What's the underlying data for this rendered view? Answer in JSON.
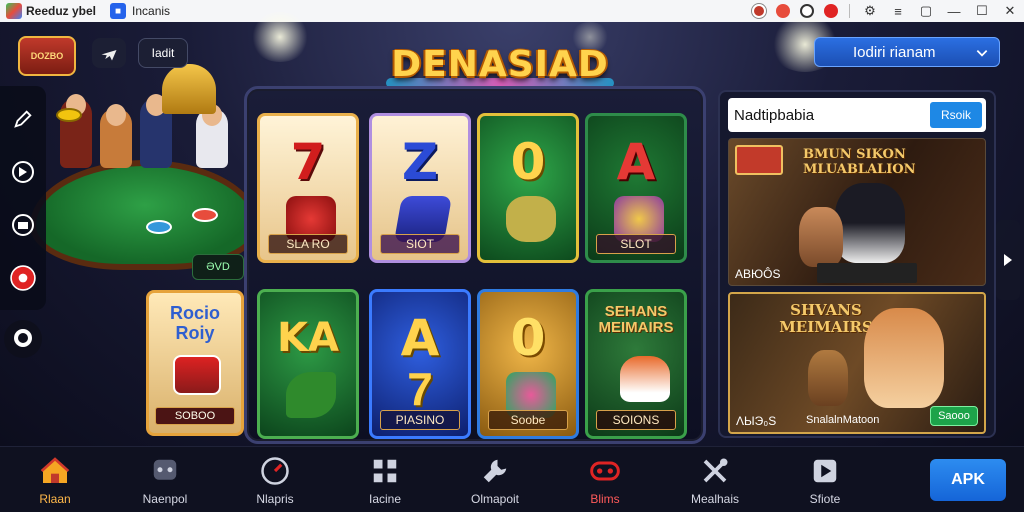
{
  "titlebar": {
    "app_name": "Reeduz ybel",
    "tab_name": "Incanis"
  },
  "top": {
    "logo_text": "DOZBO",
    "mode_chip": "Iadit",
    "select_label": "Iodiri rianam"
  },
  "game": {
    "title": "DENASIAD"
  },
  "table": {
    "tag": "ƏVD"
  },
  "reels": [
    {
      "symbol": "7",
      "label": "SLA RO",
      "theme": "cream"
    },
    {
      "symbol": "Z",
      "label": "SIOT",
      "theme": "cream"
    },
    {
      "symbol": "0",
      "label": "",
      "theme": "green"
    },
    {
      "symbol": "A",
      "label": "SLOT",
      "theme": "green"
    },
    {
      "symbol": "KA",
      "label": "",
      "theme": "green"
    },
    {
      "symbol": "A",
      "label": "PIASINO",
      "theme": "blue"
    },
    {
      "symbol": "0",
      "label": "Soobe",
      "theme": "gold"
    },
    {
      "symbol": "",
      "label": "SOIONS",
      "theme": "green"
    }
  ],
  "side_tile": {
    "title": "Rocio Roiy",
    "label": "SOBOO"
  },
  "right_panel": {
    "header": "Nadtipbabia",
    "header_button": "Rsoik",
    "card1": {
      "title": "BMUN SIKON MLUABLALION",
      "footer": "ABЮÔS"
    },
    "card2": {
      "title": "SHVANS MEIMAIRS",
      "footer": "ΛЫЭ₀Ѕ",
      "caption": "SnalalnMatoon",
      "button": "Saooo"
    }
  },
  "bottom_nav": [
    {
      "label": "Rlaan",
      "icon": "home-icon",
      "active": true
    },
    {
      "label": "Naenpol",
      "icon": "controller-icon"
    },
    {
      "label": "Nlapris",
      "icon": "gauge-icon"
    },
    {
      "label": "Iacine",
      "icon": "grid-icon"
    },
    {
      "label": "Olmapoit",
      "icon": "wrench-icon"
    },
    {
      "label": "Blims",
      "icon": "gamepad-red-icon",
      "red": true
    },
    {
      "label": "Mealhais",
      "icon": "tools-icon"
    },
    {
      "label": "Sfiote",
      "icon": "play-icon"
    }
  ],
  "apk_button": "APK"
}
